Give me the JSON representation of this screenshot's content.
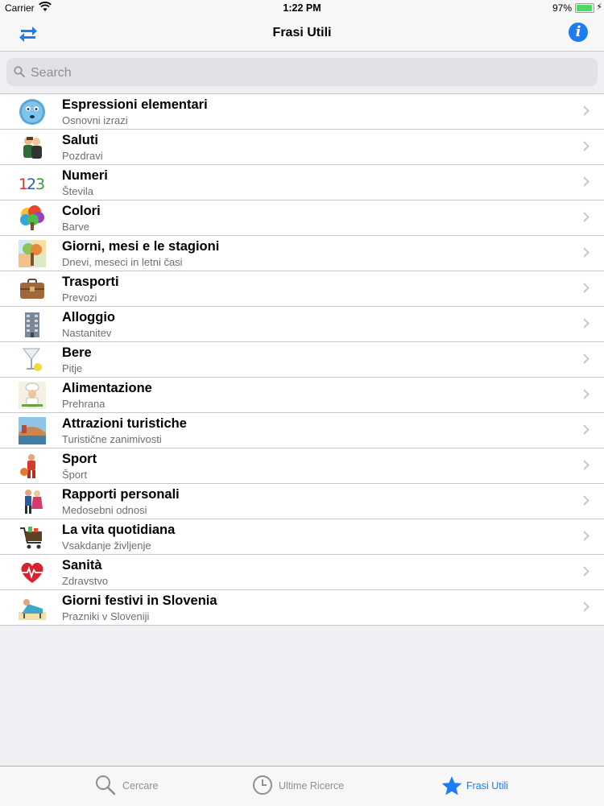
{
  "status": {
    "carrier": "Carrier",
    "time": "1:22 PM",
    "battery": "97%"
  },
  "nav": {
    "title": "Frasi Utili"
  },
  "search": {
    "placeholder": "Search"
  },
  "colors": {
    "accent": "#1b7cf6",
    "separator": "#c8c7cc",
    "background": "#efeff4"
  },
  "rows": [
    {
      "title": "Espressioni elementari",
      "subtitle": "Osnovni izrazi",
      "icon": "smiley-face-icon"
    },
    {
      "title": "Saluti",
      "subtitle": "Pozdravi",
      "icon": "greeting-people-icon"
    },
    {
      "title": "Numeri",
      "subtitle": "Števila",
      "icon": "numbers-123-icon"
    },
    {
      "title": "Colori",
      "subtitle": "Barve",
      "icon": "color-tree-icon"
    },
    {
      "title": "Giorni, mesi e le stagioni",
      "subtitle": "Dnevi, meseci in letni časi",
      "icon": "seasons-tree-icon"
    },
    {
      "title": "Trasporti",
      "subtitle": "Prevozi",
      "icon": "suitcase-icon"
    },
    {
      "title": "Alloggio",
      "subtitle": "Nastanitev",
      "icon": "building-icon"
    },
    {
      "title": "Bere",
      "subtitle": "Pitje",
      "icon": "cocktail-glass-icon"
    },
    {
      "title": "Alimentazione",
      "subtitle": "Prehrana",
      "icon": "chef-icon"
    },
    {
      "title": "Attrazioni turistiche",
      "subtitle": "Turistične zanimivosti",
      "icon": "bridge-landmark-icon"
    },
    {
      "title": "Sport",
      "subtitle": "Šport",
      "icon": "basketball-player-icon"
    },
    {
      "title": "Rapporti personali",
      "subtitle": "Medosebni odnosi",
      "icon": "couple-icon"
    },
    {
      "title": "La vita quotidiana",
      "subtitle": "Vsakdanje življenje",
      "icon": "shopping-cart-icon"
    },
    {
      "title": "Sanità",
      "subtitle": "Zdravstvo",
      "icon": "heartbeat-icon"
    },
    {
      "title": "Giorni festivi in Slovenia",
      "subtitle": "Prazniki v Sloveniji",
      "icon": "beach-chair-icon"
    }
  ],
  "tabs": [
    {
      "label": "Cercare",
      "icon": "magnifier-icon",
      "active": false
    },
    {
      "label": "Ultime Ricerce",
      "icon": "clock-icon",
      "active": false
    },
    {
      "label": "Frasi Utili",
      "icon": "star-icon",
      "active": true
    }
  ]
}
